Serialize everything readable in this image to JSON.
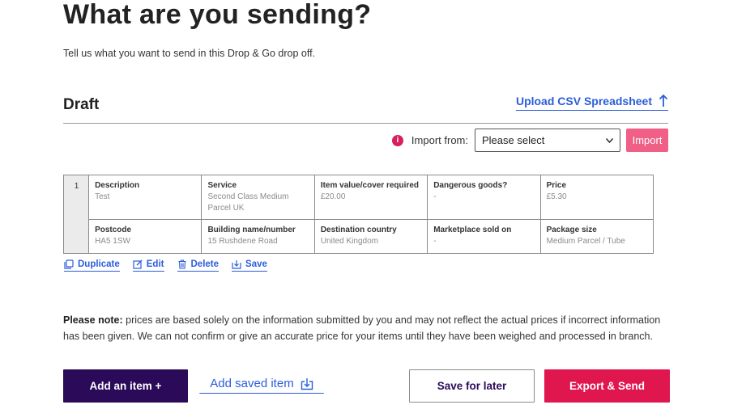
{
  "page": {
    "title": "What are you sending?",
    "intro": "Tell us what you want to send in this Drop & Go drop off."
  },
  "draft": {
    "title": "Draft",
    "upload_label": "Upload CSV Spreadsheet",
    "import_label": "Import from:",
    "import_selected": "Please select",
    "import_button": "Import",
    "info_glyph": "i"
  },
  "item": {
    "number": "1",
    "row1": [
      {
        "label": "Description",
        "value": "Test"
      },
      {
        "label": "Service",
        "value": "Second Class Medium Parcel UK"
      },
      {
        "label": "Item value/cover required",
        "value": "£20.00"
      },
      {
        "label": "Dangerous goods?",
        "value": "-"
      },
      {
        "label": "Price",
        "value": "£5.30"
      }
    ],
    "row2": [
      {
        "label": "Postcode",
        "value": "HA5 1SW"
      },
      {
        "label": "Building name/number",
        "value": "15 Rushdene Road"
      },
      {
        "label": "Destination country",
        "value": "United Kingdom"
      },
      {
        "label": "Marketplace sold on",
        "value": "-"
      },
      {
        "label": "Package size",
        "value": "Medium Parcel / Tube"
      }
    ]
  },
  "actions": {
    "duplicate": "Duplicate",
    "edit": "Edit",
    "delete": "Delete",
    "save": "Save"
  },
  "note": {
    "bold": "Please note:",
    "text": " prices are based solely on the information submitted by you and may not reflect the actual prices if incorrect information has been given. We can not confirm or give an accurate price for your items until they have been weighed and processed in branch."
  },
  "footer": {
    "add_item": "Add an item +",
    "add_saved": "Add saved item",
    "save_later": "Save for later",
    "export_send": "Export & Send"
  },
  "colors": {
    "link_blue": "#2b5ddb",
    "primary_purple": "#2b0a59",
    "accent_red": "#e0164f",
    "import_pink": "#ef5f86"
  },
  "icons": {
    "upload": "arrow-up-icon",
    "info": "info-icon",
    "dropdown": "chevron-down-icon",
    "duplicate": "copy-icon",
    "edit": "pencil-icon",
    "delete": "trash-icon",
    "save": "save-icon",
    "add_saved": "download-box-icon"
  }
}
